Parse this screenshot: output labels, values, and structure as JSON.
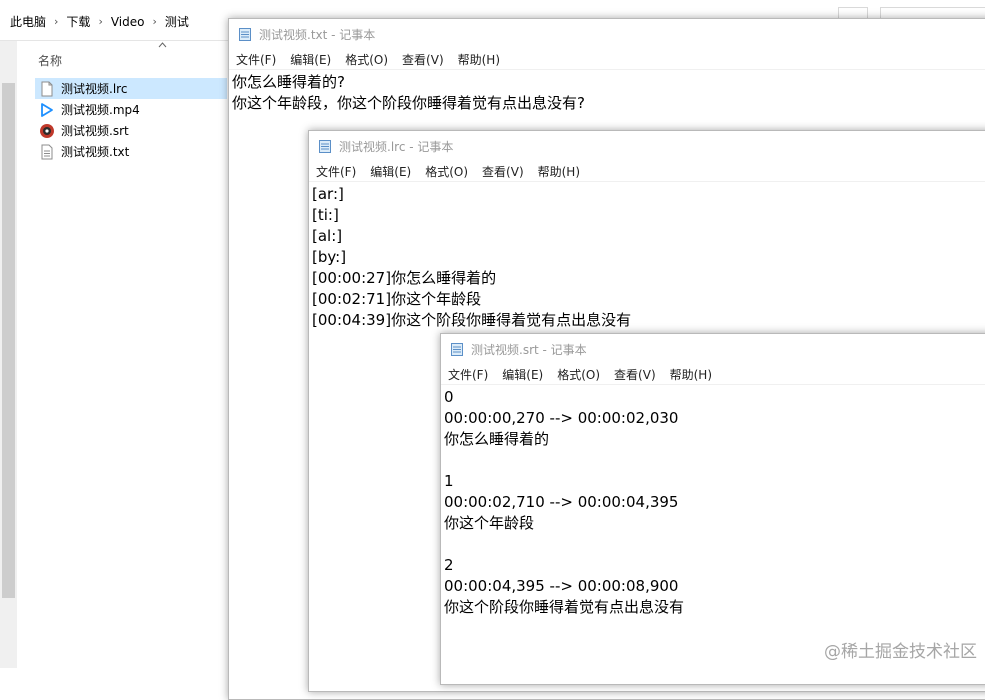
{
  "explorer": {
    "breadcrumb": [
      "此电脑",
      "下载",
      "Video",
      "测试"
    ],
    "column_name": "名称",
    "files": [
      {
        "name": "测试视频.lrc",
        "icon": "text-file-icon",
        "selected": true
      },
      {
        "name": "测试视频.mp4",
        "icon": "play-icon",
        "selected": false
      },
      {
        "name": "测试视频.srt",
        "icon": "media-player-icon",
        "selected": false
      },
      {
        "name": "测试视频.txt",
        "icon": "notepad-file-icon",
        "selected": false
      }
    ]
  },
  "menu": [
    "文件(F)",
    "编辑(E)",
    "格式(O)",
    "查看(V)",
    "帮助(H)"
  ],
  "windows": {
    "txt": {
      "title": "测试视频.txt - 记事本",
      "lines": [
        "你怎么睡得着的?",
        "你这个年龄段，你这个阶段你睡得着觉有点出息没有?"
      ]
    },
    "lrc": {
      "title": "测试视频.lrc - 记事本",
      "lines": [
        "[ar:]",
        "[ti:]",
        "[al:]",
        "[by:]",
        "[00:00:27]你怎么睡得着的",
        "[00:02:71]你这个年龄段",
        "[00:04:39]你这个阶段你睡得着觉有点出息没有"
      ]
    },
    "srt": {
      "title": "测试视频.srt - 记事本",
      "lines": [
        "0",
        "00:00:00,270 --> 00:00:02,030",
        "你怎么睡得着的",
        "",
        "1",
        "00:00:02,710 --> 00:00:04,395",
        "你这个年龄段",
        "",
        "2",
        "00:00:04,395 --> 00:00:08,900",
        "你这个阶段你睡得着觉有点出息没有"
      ]
    }
  },
  "watermark": "@稀土掘金技术社区"
}
